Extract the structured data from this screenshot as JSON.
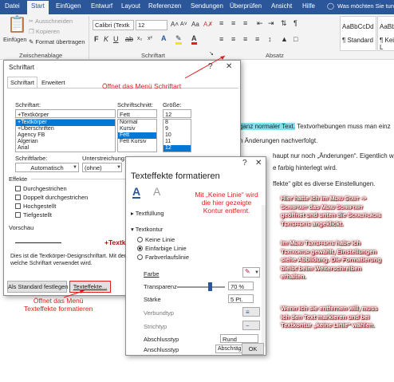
{
  "ribbon": {
    "tabs": [
      "Datei",
      "Start",
      "Einfügen",
      "Entwurf",
      "Layout",
      "Referenzen",
      "Sendungen",
      "Überprüfen",
      "Ansicht",
      "Hilfe"
    ],
    "active_tab": "Start",
    "tell_me": "Was möchten Sie tun?",
    "clipboard": {
      "paste": "Einfügen",
      "cut": "Ausschneiden",
      "copy": "Kopieren",
      "format_painter": "Format übertragen",
      "group": "Zwischenablage"
    },
    "font": {
      "name": "Calibri (Textk",
      "size": "12",
      "group": "Schriftart"
    },
    "paragraph_group": "Absatz",
    "styles": [
      {
        "preview": "AaBbCcDd",
        "name": "¶ Standard"
      },
      {
        "preview": "AaBbCcD",
        "name": "¶ Kein L"
      }
    ]
  },
  "document": {
    "lines": [
      {
        "highlight": "ganz normaler Text.",
        "rest": " Textvorhebungen muss man einz"
      },
      {
        "text": "n Änderungen nachverfolgt."
      },
      {
        "text": "haupt nur noch „Änderungen“. Eigentlich wi"
      },
      {
        "text": "e farbig hinterlegt wird."
      },
      {
        "text": "ffekte“ gibt es diverse Einstellungen."
      }
    ]
  },
  "font_dialog": {
    "title": "Schriftart",
    "tabs": [
      "Schriftart",
      "Erweitert"
    ],
    "font_label": "Schriftart:",
    "font_value": "+Textkörper",
    "font_list": [
      "+Textkörper",
      "+Überschriften",
      "Agency FB",
      "Algerian",
      "Arial"
    ],
    "style_label": "Schriftschnitt:",
    "style_value": "Fett",
    "style_list": [
      "Normal",
      "Kursiv",
      "Fett",
      "Fett Kursiv"
    ],
    "size_label": "Größe:",
    "size_value": "12",
    "size_list": [
      "8",
      "9",
      "10",
      "11",
      "12"
    ],
    "color_label": "Schriftfarbe:",
    "color_value": "Automatisch",
    "underline_label": "Unterstreichung:",
    "underline_value": "(ohne)",
    "effects_label": "Effekte",
    "effects": [
      "Durchgestrichen",
      "Doppelt durchgestrichen",
      "Hochgestellt",
      "Tiefgestellt"
    ],
    "preview_label": "Vorschau",
    "preview_text": "+Textk",
    "description": "Dies ist die Textkörper-Designschriftart. Mit der",
    "description2": "welche Schriftart verwendet wird.",
    "btn_default": "Als Standard festlegen",
    "btn_effects": "Texteffekte..."
  },
  "effects_dialog": {
    "title": "Texteffekte formatieren",
    "fill_section": "Textfüllung",
    "outline_section": "Textkontur",
    "options": [
      "Keine Linie",
      "Einfarbige Linie",
      "Farbverlaufslinie"
    ],
    "props": [
      {
        "label": "Farbe"
      },
      {
        "label": "Transparenz",
        "value": "70 %"
      },
      {
        "label": "Stärke",
        "value": "5 Pt."
      },
      {
        "label": "Verbundtyp"
      },
      {
        "label": "Strichtyp"
      },
      {
        "label": "Abschlusstyp",
        "value": "Rund"
      },
      {
        "label": "Anschlusstyp",
        "value": "Abschrägung"
      }
    ],
    "transparency_fraction": 0.7,
    "ok": "OK"
  },
  "annotations": {
    "open_font": "Öffnet das Menü Schriftart",
    "no_line_1": "Mit „Keine Linie“ wird",
    "no_line_2": "die hier gezeigte",
    "no_line_3": "Kontur entfernt.",
    "open_effects_1": "Öffnet das Menü",
    "open_effects_2": "Texteffekte formatieren"
  },
  "sidebar_text": {
    "p1_a": "Hier hatte ich im ",
    "p1_b": "Menü Start ->",
    "p1_c": "Schriftart",
    "p1_d": " das ",
    "p1_e": "Menü Schriftart",
    "p1_f": "geöffnet und unten die ",
    "p1_g": "Schaltfläche",
    "p1_h": "Texteffekte",
    "p1_i": " angeklickt.",
    "p2_a": "Im ",
    "p2_b": "Menü Texteffekte",
    "p2_c": " habe ich",
    "p2_d": "Textkontur",
    "p2_e": " gewählt, Einstellungen",
    "p2_f": "siehe Abbildung. Die Formatierung",
    "p2_g": "bleibt beim Weiterschreiben",
    "p2_h": "erhalten.",
    "p3_a": "Wenn ich sie entfernen will, muss",
    "p3_b": "ich den Text markieren und bei",
    "p3_c": "Textkontur „keine Linie“ wählen."
  },
  "colors": {
    "ribbon_blue": "#2b579a",
    "annotation_red": "#e02020",
    "highlight": "#7fe3f3",
    "selection": "#0078d7"
  }
}
